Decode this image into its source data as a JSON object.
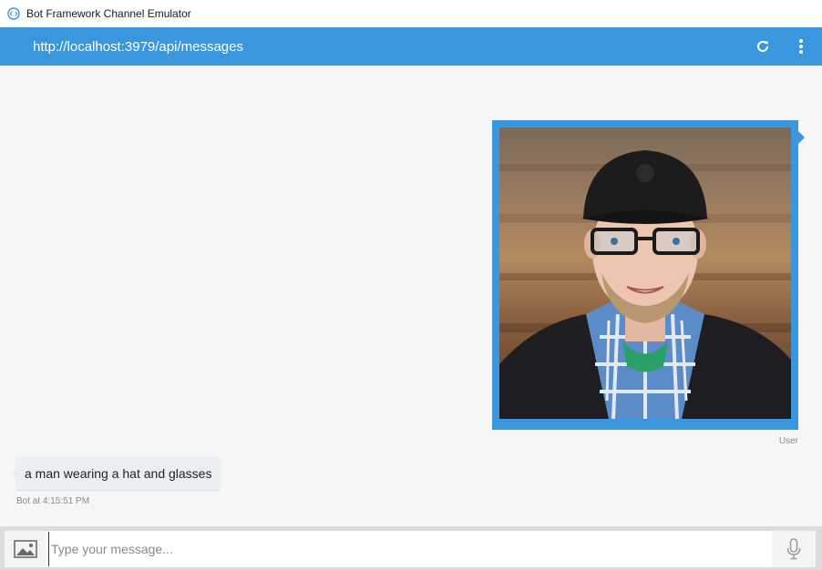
{
  "window": {
    "title": "Bot Framework Channel Emulator",
    "icon": "bot-emulator-icon"
  },
  "header": {
    "endpoint_url": "http://localhost:3979/api/messages",
    "refresh_icon": "refresh-icon",
    "menu_icon": "more-vertical-icon",
    "bg_color": "#3a96dd"
  },
  "messages": [
    {
      "sender": "user",
      "type": "image",
      "image_description_icon": "portrait-photo",
      "label": "User"
    },
    {
      "sender": "bot",
      "type": "text",
      "text": "a man wearing a hat and glasses",
      "timestamp": "Bot at 4:15:51 PM"
    }
  ],
  "composer": {
    "placeholder": "Type your message...",
    "value": "",
    "upload_icon": "image-upload-icon",
    "mic_icon": "microphone-icon"
  },
  "colors": {
    "accent": "#3a96dd",
    "chat_bg": "#f6f6f6",
    "bot_bubble": "#eceff1"
  }
}
